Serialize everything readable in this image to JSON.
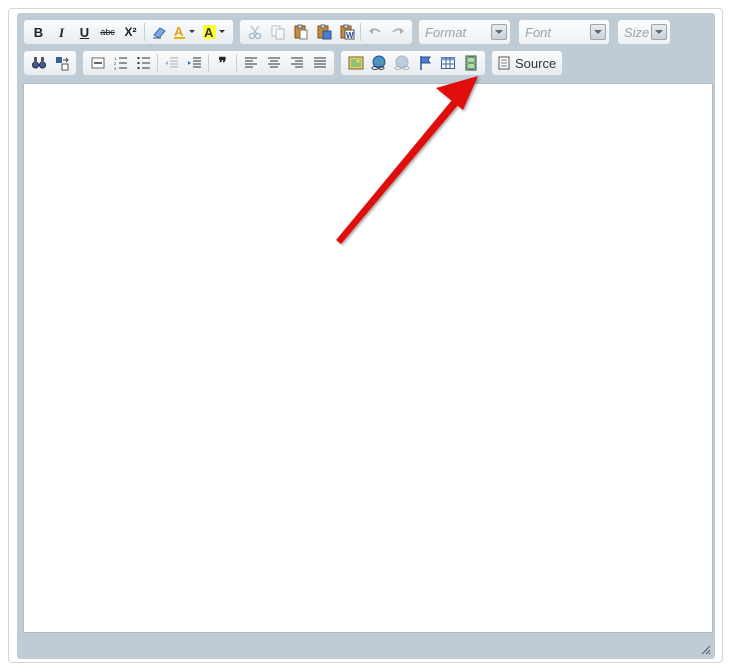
{
  "toolbar": {
    "format_combo": {
      "label": "Format"
    },
    "font_combo": {
      "label": "Font"
    },
    "size_combo": {
      "label": "Size"
    },
    "source_button": {
      "label": "Source"
    },
    "bold_glyph": "B",
    "italic_glyph": "I",
    "underline_glyph": "U",
    "strike_glyph": "abc",
    "superscript_glyph": "X²",
    "blockquote_glyph": "❞"
  },
  "colors": {
    "annotation_arrow": "#e01010",
    "highlight_yellow": "#ffff33",
    "toolbar_bg": "#bfccd5"
  },
  "annotation": {
    "target": "flash-video-button"
  }
}
